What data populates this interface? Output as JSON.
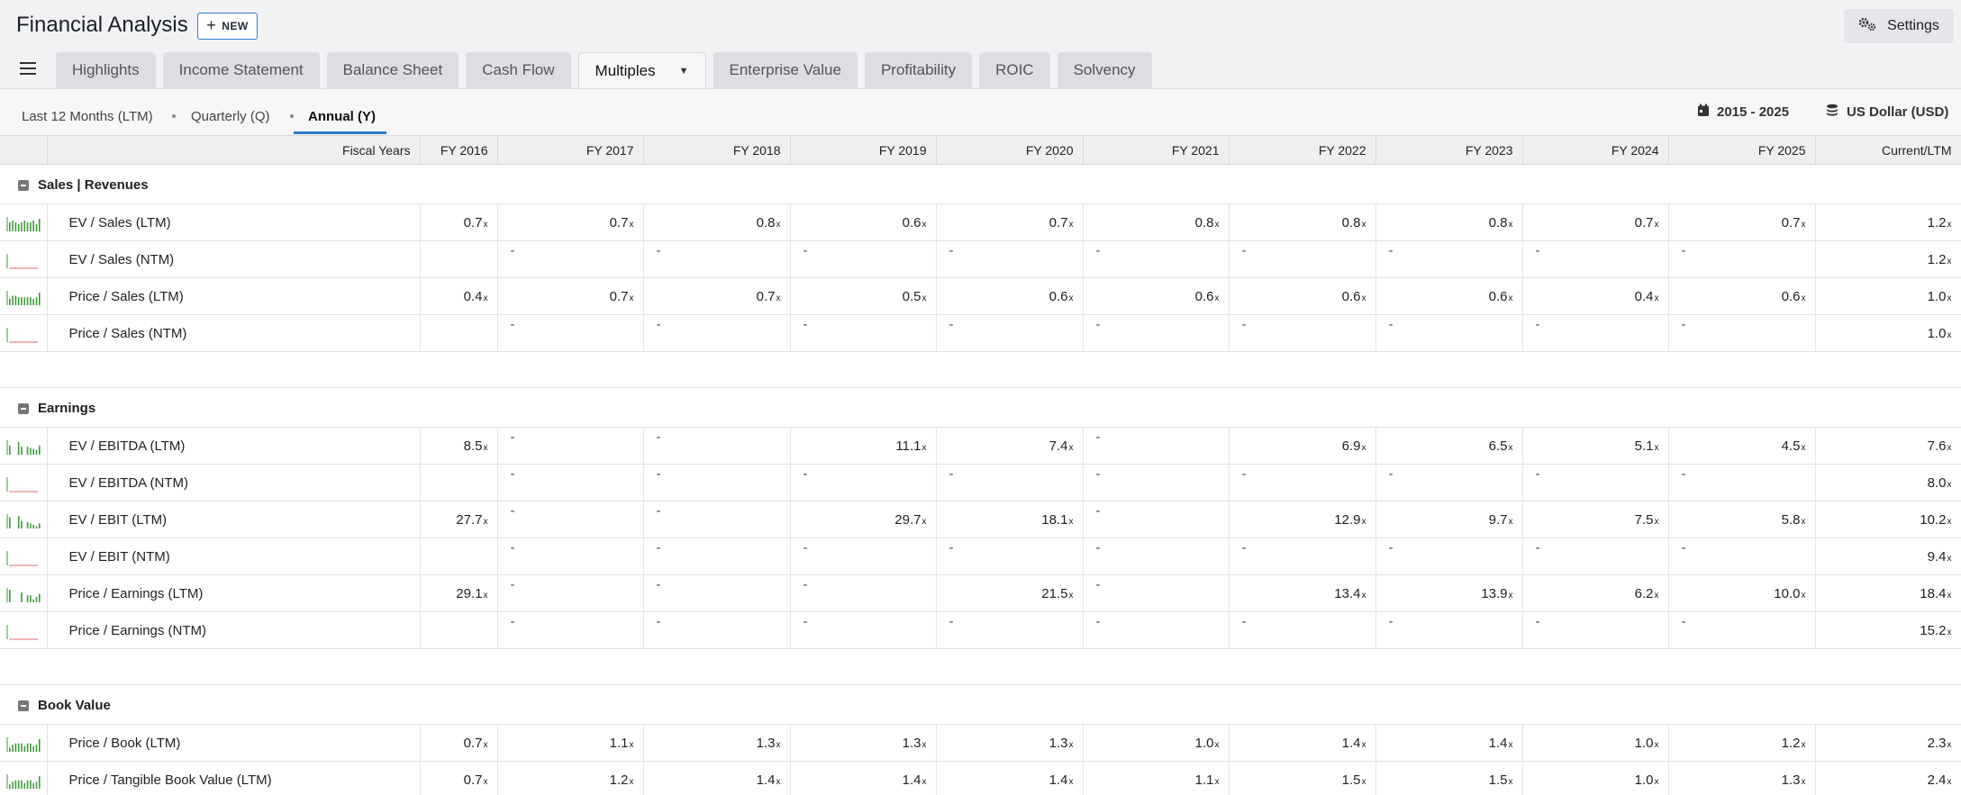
{
  "header": {
    "title": "Financial Analysis",
    "new_label": "NEW",
    "settings_label": "Settings"
  },
  "tabs": [
    "Highlights",
    "Income Statement",
    "Balance Sheet",
    "Cash Flow",
    "Multiples",
    "Enterprise Value",
    "Profitability",
    "ROIC",
    "Solvency"
  ],
  "active_tab": "Multiples",
  "periods": [
    "Last 12 Months (LTM)",
    "Quarterly (Q)",
    "Annual (Y)"
  ],
  "active_period": "Annual (Y)",
  "range": {
    "years": "2015 - 2025",
    "currency": "US Dollar (USD)"
  },
  "columns": [
    "Fiscal Years",
    "FY 2016",
    "FY 2017",
    "FY 2018",
    "FY 2019",
    "FY 2020",
    "FY 2021",
    "FY 2022",
    "FY 2023",
    "FY 2024",
    "FY 2025",
    "Current/LTM"
  ],
  "sections": [
    {
      "title": "Sales | Revenues",
      "rows": [
        {
          "label": "EV / Sales (LTM)",
          "cells": [
            "0.7",
            "0.7",
            "0.8",
            "0.6",
            "0.7",
            "0.8",
            "0.8",
            "0.8",
            "0.7",
            "0.7",
            "1.2"
          ],
          "spark": [
            5,
            6,
            5,
            4,
            5,
            6,
            5,
            5,
            6,
            4,
            7
          ]
        },
        {
          "label": "EV / Sales (NTM)",
          "cells": [
            "",
            "-",
            "-",
            "-",
            "-",
            "-",
            "-",
            "-",
            "-",
            "-",
            "1.2"
          ],
          "spark": []
        },
        {
          "label": "Price / Sales (LTM)",
          "cells": [
            "0.4",
            "0.7",
            "0.7",
            "0.5",
            "0.6",
            "0.6",
            "0.6",
            "0.6",
            "0.4",
            "0.6",
            "1.0"
          ],
          "spark": [
            4,
            6,
            6,
            5,
            5,
            5,
            5,
            5,
            4,
            5,
            8
          ]
        },
        {
          "label": "Price / Sales (NTM)",
          "cells": [
            "",
            "-",
            "-",
            "-",
            "-",
            "-",
            "-",
            "-",
            "-",
            "-",
            "1.0"
          ],
          "spark": []
        }
      ]
    },
    {
      "title": "Earnings",
      "rows": [
        {
          "label": "EV / EBITDA (LTM)",
          "cells": [
            "8.5",
            "-",
            "-",
            "11.1",
            "7.4",
            "-",
            "6.9",
            "6.5",
            "5.1",
            "4.5",
            "7.6"
          ],
          "spark": [
            8,
            0,
            0,
            11,
            7,
            0,
            7,
            6,
            5,
            4,
            8
          ]
        },
        {
          "label": "EV / EBITDA (NTM)",
          "cells": [
            "",
            "-",
            "-",
            "-",
            "-",
            "-",
            "-",
            "-",
            "-",
            "-",
            "8.0"
          ],
          "spark": []
        },
        {
          "label": "EV / EBIT (LTM)",
          "cells": [
            "27.7",
            "-",
            "-",
            "29.7",
            "18.1",
            "-",
            "12.9",
            "9.7",
            "7.5",
            "5.8",
            "10.2"
          ],
          "spark": [
            9,
            0,
            0,
            10,
            6,
            0,
            5,
            4,
            3,
            2,
            4
          ]
        },
        {
          "label": "EV / EBIT (NTM)",
          "cells": [
            "",
            "-",
            "-",
            "-",
            "-",
            "-",
            "-",
            "-",
            "-",
            "-",
            "9.4"
          ],
          "spark": []
        },
        {
          "label": "Price / Earnings (LTM)",
          "cells": [
            "29.1",
            "-",
            "-",
            "-",
            "21.5",
            "-",
            "13.4",
            "13.9",
            "6.2",
            "10.0",
            "18.4"
          ],
          "spark": [
            9,
            0,
            0,
            0,
            7,
            0,
            5,
            5,
            2,
            4,
            6
          ]
        },
        {
          "label": "Price / Earnings (NTM)",
          "cells": [
            "",
            "-",
            "-",
            "-",
            "-",
            "-",
            "-",
            "-",
            "-",
            "-",
            "15.2"
          ],
          "spark": []
        }
      ]
    },
    {
      "title": "Book Value",
      "rows": [
        {
          "label": "Price / Book (LTM)",
          "cells": [
            "0.7",
            "1.1",
            "1.3",
            "1.3",
            "1.3",
            "1.0",
            "1.4",
            "1.4",
            "1.0",
            "1.2",
            "2.3"
          ],
          "spark": [
            3,
            5,
            6,
            6,
            6,
            4,
            6,
            6,
            4,
            5,
            9
          ]
        },
        {
          "label": "Price / Tangible Book Value (LTM)",
          "cells": [
            "0.7",
            "1.2",
            "1.4",
            "1.4",
            "1.4",
            "1.1",
            "1.5",
            "1.5",
            "1.0",
            "1.3",
            "2.4"
          ],
          "spark": [
            3,
            5,
            6,
            6,
            6,
            4,
            6,
            6,
            4,
            5,
            9
          ]
        }
      ]
    }
  ],
  "suffix": "x",
  "colors": {
    "accent": "#2b7bd8",
    "spark_green": "#3f9a3a",
    "spark_red": "#e06b6b"
  }
}
